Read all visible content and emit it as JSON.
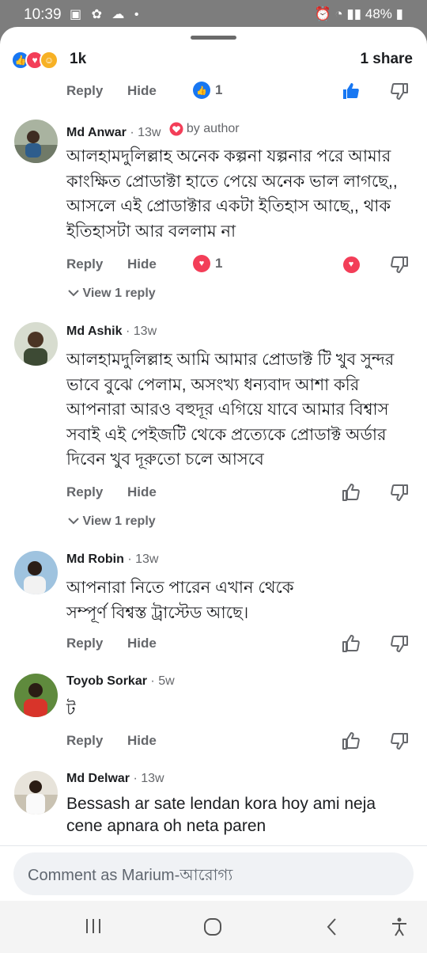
{
  "status_bar": {
    "time": "10:39",
    "battery": "48%"
  },
  "summary": {
    "reaction_count": "1k",
    "share_count": "1 share"
  },
  "top_actions": {
    "reply": "Reply",
    "hide": "Hide",
    "reaction_count": "1"
  },
  "comments": [
    {
      "name": "Md Anwar",
      "time": "13w",
      "author_badge": "by author",
      "text": "আলহামদুলিল্লাহ অনেক কল্পনা যল্পনার পরে আমার কাংক্ষিত প্রোডাক্টা হাতে পেয়ে অনেক ভাল লাগছে,, আসলে এই প্রোডাক্টার একটা ইতিহাস আছে,, থাক ইতিহাসটা আর বললাম না",
      "reply": "Reply",
      "hide": "Hide",
      "reaction_count": "1",
      "view_replies": "View 1 reply"
    },
    {
      "name": "Md Ashik",
      "time": "13w",
      "text": "আলহামদুলিল্লাহ আমি আমার প্রোডাক্ট টি খুব সুন্দর ভাবে বুঝে পেলাম, অসংখ্য ধন্যবাদ আশা করি আপনারা আরও বহুদূর এগিয়ে যাবে আমার বিশ্বাস সবাই এই পেইজটি থেকে প্রত্যেকে প্রোডাক্ট অর্ডার দিবেন খুব  দূরুতো চলে আসবে",
      "reply": "Reply",
      "hide": "Hide",
      "view_replies": "View 1 reply"
    },
    {
      "name": "Md Robin",
      "time": "13w",
      "text": "আপনারা নিতে পারেন এখান থেকে সম্পূর্ণ বিশ্বস্ত ট্রাস্টেড আছে।",
      "reply": "Reply",
      "hide": "Hide"
    },
    {
      "name": "Toyob Sorkar",
      "time": "5w",
      "text": "ট",
      "reply": "Reply",
      "hide": "Hide"
    },
    {
      "name": "Md Delwar",
      "time": "13w",
      "text": "Bessash ar sate lendan kora hoy ami neja cene apnara oh neta paren"
    }
  ],
  "composer": {
    "placeholder": "Comment as Marium-আরোগ্য"
  },
  "colors": {
    "primary": "#1877f2",
    "love": "#f33e58",
    "muted": "#65676b"
  },
  "icons": [
    "like-icon",
    "love-icon",
    "care-icon",
    "thumbs-up-icon",
    "thumbs-down-icon",
    "chevron-down-icon",
    "recents-icon",
    "home-icon",
    "back-icon",
    "accessibility-icon"
  ]
}
